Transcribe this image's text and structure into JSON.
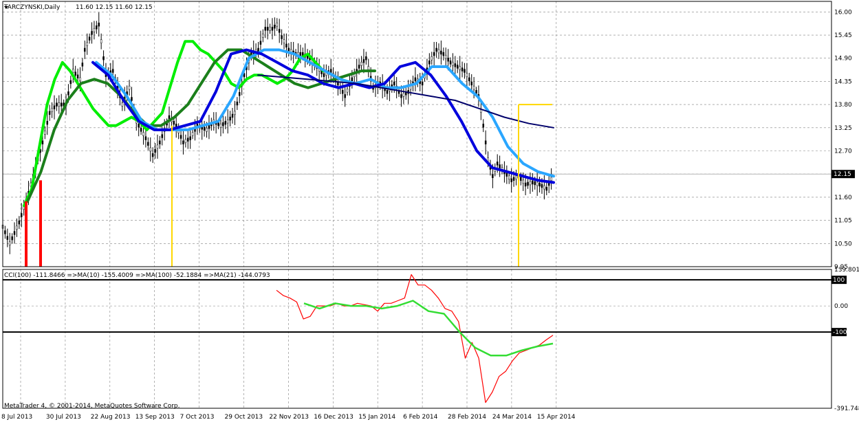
{
  "header": {
    "symbol_label": "TARCZYNSKI,Daily",
    "ohlc_label": "11.60 12.15 11.60 12.15",
    "dropdown_icon": "triangle-down-icon"
  },
  "footer": {
    "copyright": "MetaTrader 4, © 2001-2014, MetaQuotes Software Corp."
  },
  "colors": {
    "candle": "#000000",
    "ma_light_green": "#00ee00",
    "ma_dark_green": "#1b7f1b",
    "ma_light_blue": "#2aa6ff",
    "ma_blue": "#0000dd",
    "ma_navy": "#00006b",
    "signal_red": "#ff0000",
    "signal_yellow": "#ffd700",
    "cci": "#ff0000",
    "cci_ma": "#33dd33",
    "grid": "#808080"
  },
  "chart_data": [
    {
      "type": "candlestick",
      "title": "TARCZYNSKI,Daily",
      "ylim": [
        9.95,
        16.25
      ],
      "y_ticks": [
        "16.00",
        "15.45",
        "14.90",
        "14.35",
        "13.80",
        "13.25",
        "12.70",
        "12.15",
        "11.60",
        "11.05",
        "10.50",
        "9.95"
      ],
      "current_price": "12.15",
      "x_ticks": [
        "8 Jul 2013",
        "30 Jul 2013",
        "22 Aug 2013",
        "13 Sep 2013",
        "7 Oct 2013",
        "29 Oct 2013",
        "22 Nov 2013",
        "16 Dec 2013",
        "15 Jan 2014",
        "6 Feb 2014",
        "28 Feb 2014",
        "24 Mar 2014",
        "15 Apr 2014"
      ],
      "close_path": [
        [
          0,
          10.9
        ],
        [
          3,
          10.5
        ],
        [
          7,
          11.0
        ],
        [
          11,
          11.7
        ],
        [
          14,
          12.3
        ],
        [
          17,
          12.9
        ],
        [
          20,
          13.6
        ],
        [
          23,
          13.8
        ],
        [
          27,
          13.8
        ],
        [
          30,
          14.6
        ],
        [
          33,
          14.4
        ],
        [
          35,
          15.1
        ],
        [
          38,
          15.5
        ],
        [
          41,
          15.7
        ],
        [
          44,
          14.5
        ],
        [
          47,
          14.6
        ],
        [
          51,
          13.8
        ],
        [
          54,
          14.2
        ],
        [
          57,
          13.4
        ],
        [
          61,
          13.0
        ],
        [
          64,
          12.6
        ],
        [
          67,
          12.9
        ],
        [
          71,
          13.5
        ],
        [
          74,
          13.3
        ],
        [
          77,
          12.9
        ],
        [
          80,
          13.0
        ],
        [
          83,
          13.3
        ],
        [
          87,
          13.2
        ],
        [
          90,
          13.4
        ],
        [
          93,
          13.3
        ],
        [
          96,
          13.4
        ],
        [
          99,
          13.6
        ],
        [
          103,
          14.5
        ],
        [
          106,
          15.0
        ],
        [
          109,
          15.1
        ],
        [
          112,
          15.6
        ],
        [
          115,
          15.6
        ],
        [
          117,
          15.7
        ],
        [
          119,
          15.4
        ],
        [
          122,
          15.1
        ],
        [
          125,
          15.0
        ],
        [
          128,
          15.0
        ],
        [
          131,
          14.9
        ],
        [
          134,
          14.7
        ],
        [
          137,
          14.5
        ],
        [
          140,
          14.6
        ],
        [
          143,
          14.3
        ],
        [
          146,
          14.0
        ],
        [
          149,
          14.4
        ],
        [
          152,
          14.7
        ],
        [
          155,
          14.9
        ],
        [
          158,
          14.2
        ],
        [
          161,
          14.3
        ],
        [
          164,
          14.1
        ],
        [
          167,
          14.3
        ],
        [
          170,
          14.0
        ],
        [
          173,
          14.1
        ],
        [
          176,
          14.4
        ],
        [
          179,
          14.3
        ],
        [
          182,
          14.8
        ],
        [
          185,
          15.1
        ],
        [
          188,
          15.0
        ],
        [
          191,
          14.8
        ],
        [
          194,
          14.7
        ],
        [
          197,
          14.6
        ],
        [
          200,
          14.3
        ],
        [
          203,
          14.0
        ],
        [
          205,
          13.3
        ],
        [
          207,
          12.5
        ],
        [
          209,
          12.1
        ],
        [
          211,
          12.4
        ],
        [
          214,
          12.2
        ],
        [
          217,
          12.0
        ],
        [
          220,
          12.1
        ],
        [
          223,
          11.9
        ],
        [
          226,
          11.95
        ],
        [
          229,
          11.9
        ],
        [
          232,
          11.8
        ],
        [
          235,
          12.15
        ]
      ],
      "series": [
        {
          "name": "",
          "color": "light green",
          "values": [
            [
              0,
              11.4
            ],
            [
              3,
              11.8
            ],
            [
              6,
              12.8
            ],
            [
              9,
              13.8
            ],
            [
              12,
              14.4
            ],
            [
              15,
              14.8
            ],
            [
              18,
              14.6
            ],
            [
              21,
              14.3
            ],
            [
              24,
              14.0
            ],
            [
              27,
              13.7
            ],
            [
              30,
              13.5
            ],
            [
              33,
              13.3
            ],
            [
              36,
              13.3
            ],
            [
              39,
              13.4
            ],
            [
              42,
              13.5
            ],
            [
              45,
              13.4
            ],
            [
              48,
              13.2
            ],
            [
              51,
              13.4
            ],
            [
              54,
              13.6
            ],
            [
              57,
              14.2
            ],
            [
              60,
              14.8
            ],
            [
              63,
              15.3
            ],
            [
              66,
              15.3
            ],
            [
              69,
              15.1
            ],
            [
              72,
              15.0
            ],
            [
              75,
              14.8
            ],
            [
              78,
              14.6
            ],
            [
              81,
              14.3
            ],
            [
              84,
              14.2
            ],
            [
              87,
              14.4
            ],
            [
              90,
              14.5
            ],
            [
              93,
              14.5
            ],
            [
              96,
              14.4
            ],
            [
              99,
              14.3
            ],
            [
              102,
              14.4
            ],
            [
              105,
              14.6
            ],
            [
              108,
              14.9
            ],
            [
              111,
              15.0
            ],
            [
              114,
              14.8
            ],
            [
              117,
              14.6
            ]
          ]
        },
        {
          "name": "",
          "color": "dark green",
          "values": [
            [
              0,
              11.5
            ],
            [
              3,
              12.2
            ],
            [
              6,
              13.2
            ],
            [
              9,
              13.9
            ],
            [
              12,
              14.3
            ],
            [
              15,
              14.4
            ],
            [
              18,
              14.3
            ],
            [
              21,
              14.0
            ],
            [
              24,
              13.6
            ],
            [
              27,
              13.3
            ],
            [
              30,
              13.3
            ],
            [
              33,
              13.5
            ],
            [
              36,
              13.8
            ],
            [
              39,
              14.3
            ],
            [
              42,
              14.8
            ],
            [
              45,
              15.1
            ],
            [
              48,
              15.1
            ],
            [
              51,
              14.9
            ],
            [
              54,
              14.7
            ],
            [
              57,
              14.5
            ],
            [
              60,
              14.3
            ],
            [
              63,
              14.2
            ],
            [
              66,
              14.3
            ],
            [
              69,
              14.4
            ],
            [
              72,
              14.5
            ],
            [
              75,
              14.6
            ],
            [
              78,
              14.6
            ]
          ]
        },
        {
          "name": "",
          "color": "light blue",
          "values": [
            [
              0,
              14.8
            ],
            [
              3,
              14.5
            ],
            [
              6,
              14.0
            ],
            [
              9,
              13.4
            ],
            [
              12,
              13.2
            ],
            [
              15,
              13.2
            ],
            [
              18,
              13.2
            ],
            [
              21,
              13.3
            ],
            [
              24,
              13.4
            ],
            [
              27,
              14.0
            ],
            [
              30,
              14.9
            ],
            [
              33,
              15.1
            ],
            [
              36,
              15.1
            ],
            [
              39,
              15.0
            ],
            [
              42,
              14.8
            ],
            [
              45,
              14.6
            ],
            [
              48,
              14.4
            ],
            [
              51,
              14.3
            ],
            [
              54,
              14.4
            ],
            [
              57,
              14.2
            ],
            [
              60,
              14.2
            ],
            [
              63,
              14.3
            ],
            [
              66,
              14.7
            ],
            [
              69,
              14.7
            ],
            [
              72,
              14.3
            ],
            [
              75,
              14.0
            ],
            [
              78,
              13.5
            ],
            [
              81,
              12.8
            ],
            [
              84,
              12.4
            ],
            [
              87,
              12.2
            ],
            [
              90,
              12.1
            ]
          ]
        },
        {
          "name": "",
          "color": "blue",
          "values": [
            [
              0,
              14.8
            ],
            [
              3,
              14.5
            ],
            [
              6,
              13.9
            ],
            [
              9,
              13.4
            ],
            [
              12,
              13.2
            ],
            [
              15,
              13.2
            ],
            [
              18,
              13.3
            ],
            [
              21,
              13.4
            ],
            [
              24,
              14.1
            ],
            [
              27,
              15.0
            ],
            [
              30,
              15.1
            ],
            [
              33,
              15.0
            ],
            [
              36,
              14.8
            ],
            [
              39,
              14.6
            ],
            [
              42,
              14.5
            ],
            [
              45,
              14.3
            ],
            [
              48,
              14.2
            ],
            [
              51,
              14.3
            ],
            [
              54,
              14.2
            ],
            [
              57,
              14.3
            ],
            [
              60,
              14.7
            ],
            [
              63,
              14.8
            ],
            [
              66,
              14.5
            ],
            [
              69,
              14.0
            ],
            [
              72,
              13.4
            ],
            [
              75,
              12.7
            ],
            [
              78,
              12.3
            ],
            [
              81,
              12.2
            ],
            [
              84,
              12.1
            ],
            [
              87,
              12.0
            ],
            [
              90,
              11.95
            ]
          ]
        },
        {
          "name": "",
          "color": "navy",
          "values": [
            [
              0,
              14.5
            ],
            [
              3,
              14.45
            ],
            [
              6,
              14.4
            ],
            [
              9,
              14.35
            ],
            [
              12,
              14.3
            ],
            [
              15,
              14.2
            ],
            [
              18,
              14.1
            ],
            [
              21,
              14.0
            ],
            [
              24,
              13.9
            ],
            [
              27,
              13.7
            ],
            [
              30,
              13.5
            ],
            [
              33,
              13.35
            ],
            [
              36,
              13.25
            ]
          ]
        }
      ],
      "signals": [
        {
          "color": "red",
          "price_top": 11.5
        },
        {
          "color": "red",
          "price_top": 12.0
        },
        {
          "color": "yellow",
          "price_top": 13.3
        },
        {
          "color": "yellow",
          "price_top": 13.8
        }
      ]
    },
    {
      "type": "line",
      "title": "CCI(100) -111.8466 =>MA(10) -155.4009 =>MA(100) -52.1884 =>MA(21) -144.0793",
      "ylim": [
        -391.748,
        139.8014
      ],
      "y_ticks": [
        "139.8014",
        "0.00",
        "-391.748"
      ],
      "levels": [
        "100",
        "-100"
      ],
      "series": [
        {
          "name": "CCI(100)",
          "values": [
            [
              0,
              60
            ],
            [
              3,
              40
            ],
            [
              6,
              30
            ],
            [
              9,
              15
            ],
            [
              12,
              -50
            ],
            [
              15,
              -40
            ],
            [
              18,
              0
            ],
            [
              21,
              0
            ],
            [
              24,
              0
            ],
            [
              27,
              10
            ],
            [
              30,
              0
            ],
            [
              33,
              0
            ],
            [
              36,
              10
            ],
            [
              39,
              5
            ],
            [
              42,
              0
            ],
            [
              45,
              -20
            ],
            [
              48,
              10
            ],
            [
              51,
              10
            ],
            [
              54,
              20
            ],
            [
              57,
              30
            ],
            [
              60,
              120
            ],
            [
              63,
              80
            ],
            [
              66,
              80
            ],
            [
              69,
              60
            ],
            [
              72,
              30
            ],
            [
              75,
              -10
            ],
            [
              78,
              -20
            ],
            [
              81,
              -60
            ],
            [
              84,
              -200
            ],
            [
              87,
              -140
            ],
            [
              90,
              -200
            ],
            [
              93,
              -370
            ],
            [
              96,
              -330
            ],
            [
              99,
              -270
            ],
            [
              102,
              -250
            ],
            [
              105,
              -210
            ],
            [
              108,
              -180
            ],
            [
              111,
              -170
            ],
            [
              114,
              -160
            ],
            [
              117,
              -150
            ],
            [
              120,
              -130
            ],
            [
              123,
              -112
            ]
          ]
        },
        {
          "name": "MA(21)",
          "values": [
            [
              0,
              10
            ],
            [
              6,
              -10
            ],
            [
              12,
              10
            ],
            [
              18,
              0
            ],
            [
              24,
              0
            ],
            [
              30,
              -10
            ],
            [
              36,
              0
            ],
            [
              42,
              20
            ],
            [
              48,
              -20
            ],
            [
              54,
              -30
            ],
            [
              60,
              -100
            ],
            [
              66,
              -160
            ],
            [
              72,
              -190
            ],
            [
              78,
              -190
            ],
            [
              84,
              -170
            ],
            [
              90,
              -155
            ],
            [
              96,
              -144
            ]
          ]
        }
      ]
    }
  ]
}
